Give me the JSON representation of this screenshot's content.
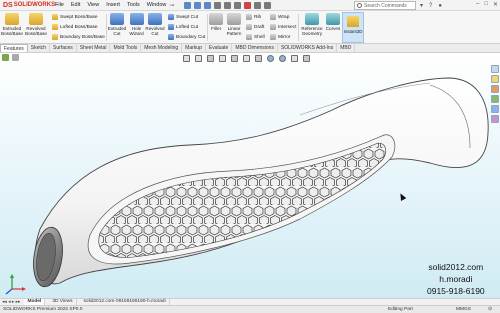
{
  "app": {
    "logo_brand": "DS",
    "logo_text": "SOLIDWORKS",
    "menu": [
      "File",
      "Edit",
      "View",
      "Insert",
      "Tools",
      "Window"
    ],
    "search_placeholder": "Search Commands"
  },
  "ribbon": {
    "extruded_boss": "Extruded Boss/Base",
    "revolved_boss": "Revolved Boss/Base",
    "swept_boss": "Swept Boss/Base",
    "lofted_boss": "Lofted Boss/Base",
    "boundary_boss": "Boundary Boss/Base",
    "extruded_cut": "Extruded Cut",
    "hole_wizard": "Hole Wizard",
    "revolved_cut": "Revolved Cut",
    "swept_cut": "Swept Cut",
    "lofted_cut": "Lofted Cut",
    "boundary_cut": "Boundary Cut",
    "fillet": "Fillet",
    "linear_pattern": "Linear Pattern",
    "rib": "Rib",
    "draft": "Draft",
    "shell": "Shell",
    "wrap": "Wrap",
    "intersect": "Intersect",
    "mirror": "Mirror",
    "reference_geometry": "Reference Geometry",
    "curves": "Curves",
    "instant3d": "Instant3D"
  },
  "tabs": [
    "Features",
    "Sketch",
    "Surfaces",
    "Sheet Metal",
    "Mold Tools",
    "Mesh Modeling",
    "Markup",
    "Evaluate",
    "MBD Dimensions",
    "SOLIDWORKS Add-Ins",
    "MBD"
  ],
  "watermark": {
    "site": "solid2012.com",
    "name": "h.moradi",
    "phone": "0915-918-6190"
  },
  "bottom_tabs": {
    "model": "Model",
    "views": "3D Views",
    "file": "solid2012.com-09159186190-h.moradi"
  },
  "status": {
    "version": "SOLIDWORKS Premium 2022 SP0.0",
    "mode": "Editing Part",
    "units": "MMGS"
  }
}
